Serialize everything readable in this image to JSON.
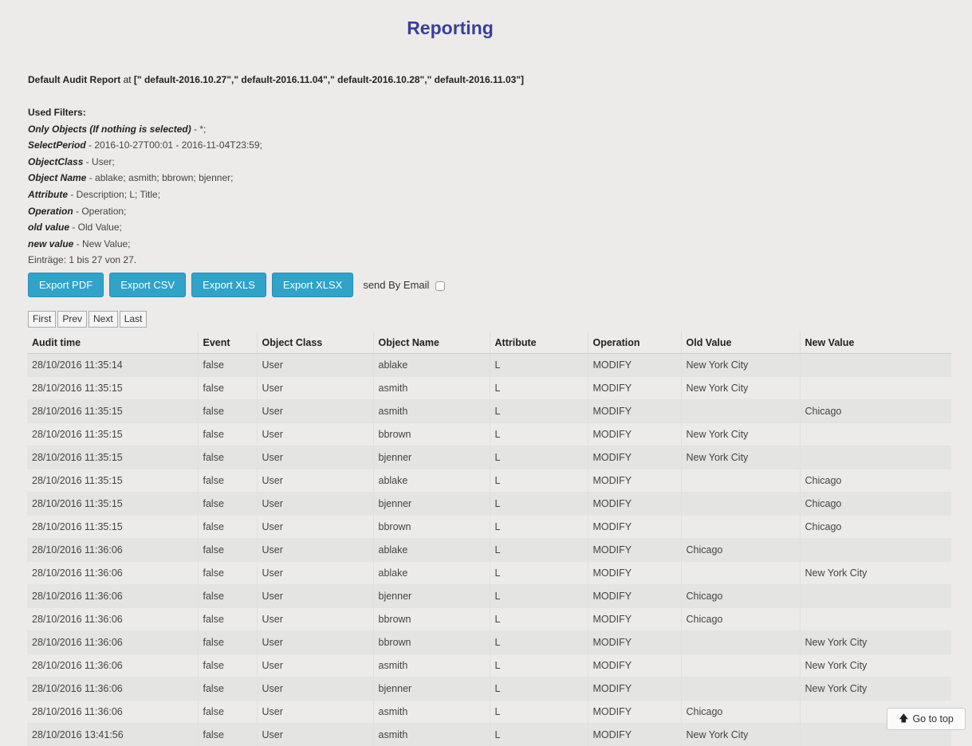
{
  "title": "Reporting",
  "report": {
    "name": "Default Audit Report",
    "at_label": "at",
    "targets": "[\" default-2016.10.27\",\" default-2016.11.04\",\" default-2016.10.28\",\" default-2016.11.03\"]"
  },
  "filters": {
    "heading": "Used Filters:",
    "items": [
      {
        "key": "Only Objects (If nothing is selected)",
        "value": " - *;"
      },
      {
        "key": "SelectPeriod",
        "value": " - 2016-10-27T00:01 - 2016-11-04T23:59;"
      },
      {
        "key": "ObjectClass",
        "value": " - User;"
      },
      {
        "key": "Object Name",
        "value": " - ablake; asmith; bbrown; bjenner;"
      },
      {
        "key": "Attribute",
        "value": " - Description; L; Title;"
      },
      {
        "key": "Operation",
        "value": " - Operation;"
      },
      {
        "key": "old value",
        "value": " - Old Value;"
      },
      {
        "key": "new value",
        "value": " - New Value;"
      }
    ],
    "entries": "Einträge: 1 bis 27 von 27."
  },
  "actions": {
    "export_pdf": "Export PDF",
    "export_csv": "Export CSV",
    "export_xls": "Export XLS",
    "export_xlsx": "Export XLSX",
    "send_email": "send By Email"
  },
  "pager": {
    "first": "First",
    "prev": "Prev",
    "next": "Next",
    "last": "Last"
  },
  "table": {
    "columns": [
      "Audit time",
      "Event",
      "Object Class",
      "Object Name",
      "Attribute",
      "Operation",
      "Old Value",
      "New Value"
    ],
    "rows": [
      [
        "28/10/2016 11:35:14",
        "false",
        "User",
        "ablake",
        "L",
        "MODIFY",
        "New York City",
        ""
      ],
      [
        "28/10/2016 11:35:15",
        "false",
        "User",
        "asmith",
        "L",
        "MODIFY",
        "New York City",
        ""
      ],
      [
        "28/10/2016 11:35:15",
        "false",
        "User",
        "asmith",
        "L",
        "MODIFY",
        "",
        "Chicago"
      ],
      [
        "28/10/2016 11:35:15",
        "false",
        "User",
        "bbrown",
        "L",
        "MODIFY",
        "New York City",
        ""
      ],
      [
        "28/10/2016 11:35:15",
        "false",
        "User",
        "bjenner",
        "L",
        "MODIFY",
        "New York City",
        ""
      ],
      [
        "28/10/2016 11:35:15",
        "false",
        "User",
        "ablake",
        "L",
        "MODIFY",
        "",
        "Chicago"
      ],
      [
        "28/10/2016 11:35:15",
        "false",
        "User",
        "bjenner",
        "L",
        "MODIFY",
        "",
        "Chicago"
      ],
      [
        "28/10/2016 11:35:15",
        "false",
        "User",
        "bbrown",
        "L",
        "MODIFY",
        "",
        "Chicago"
      ],
      [
        "28/10/2016 11:36:06",
        "false",
        "User",
        "ablake",
        "L",
        "MODIFY",
        "Chicago",
        ""
      ],
      [
        "28/10/2016 11:36:06",
        "false",
        "User",
        "ablake",
        "L",
        "MODIFY",
        "",
        "New York City"
      ],
      [
        "28/10/2016 11:36:06",
        "false",
        "User",
        "bjenner",
        "L",
        "MODIFY",
        "Chicago",
        ""
      ],
      [
        "28/10/2016 11:36:06",
        "false",
        "User",
        "bbrown",
        "L",
        "MODIFY",
        "Chicago",
        ""
      ],
      [
        "28/10/2016 11:36:06",
        "false",
        "User",
        "bbrown",
        "L",
        "MODIFY",
        "",
        "New York City"
      ],
      [
        "28/10/2016 11:36:06",
        "false",
        "User",
        "asmith",
        "L",
        "MODIFY",
        "",
        "New York City"
      ],
      [
        "28/10/2016 11:36:06",
        "false",
        "User",
        "bjenner",
        "L",
        "MODIFY",
        "",
        "New York City"
      ],
      [
        "28/10/2016 11:36:06",
        "false",
        "User",
        "asmith",
        "L",
        "MODIFY",
        "Chicago",
        ""
      ],
      [
        "28/10/2016 13:41:56",
        "false",
        "User",
        "asmith",
        "L",
        "MODIFY",
        "New York City",
        ""
      ]
    ]
  },
  "go_top": {
    "label": "Go to top",
    "icon": "arrow-up-icon"
  },
  "colors": {
    "title": "#3b3f97",
    "button": "#31a2c8"
  }
}
